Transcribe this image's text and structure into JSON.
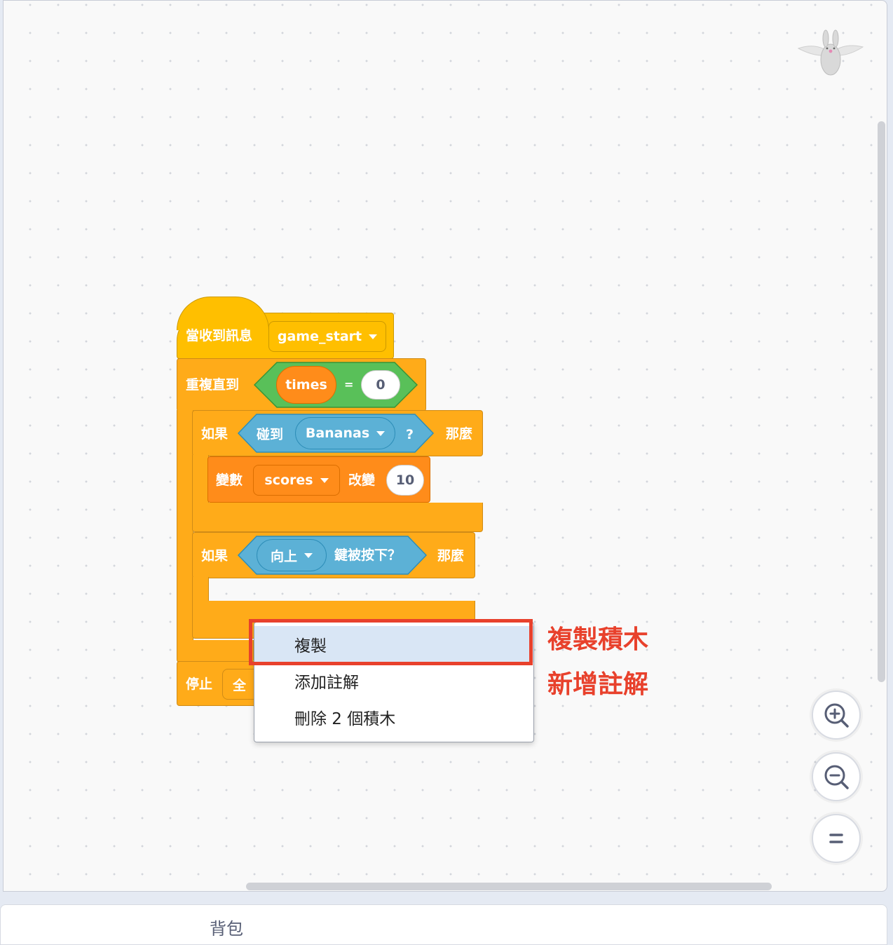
{
  "blocks": {
    "hat": {
      "label": "當收到訊息",
      "message": "game_start"
    },
    "repeat": {
      "label": "重複直到",
      "var": "times",
      "op": "=",
      "value": "0"
    },
    "if1": {
      "label": "如果",
      "touch": "碰到",
      "target": "Bananas",
      "q": "?",
      "then": "那麼"
    },
    "change": {
      "label": "變數",
      "var": "scores",
      "action": "改變",
      "value": "10"
    },
    "if2": {
      "label": "如果",
      "key": "向上",
      "pressed": "鍵被按下？",
      "then": "那麼"
    },
    "stop": {
      "label": "停止",
      "option": "全"
    }
  },
  "context_menu": {
    "items": [
      "複製",
      "添加註解",
      "刪除 2 個積木"
    ],
    "highlighted": "複製"
  },
  "annotations": {
    "duplicate": "複製積木",
    "comment": "新增註解"
  },
  "backpack": {
    "label": "背包"
  },
  "zoom_controls": [
    "zoom-in",
    "zoom-out",
    "zoom-reset"
  ],
  "colors": {
    "events": "#ffbf00",
    "control": "#ffab19",
    "variables": "#ff8c1a",
    "sensing": "#5cb1d6",
    "operators": "#59c059",
    "annotation": "#e8412c",
    "menu_highlight": "#d9e6f5"
  }
}
